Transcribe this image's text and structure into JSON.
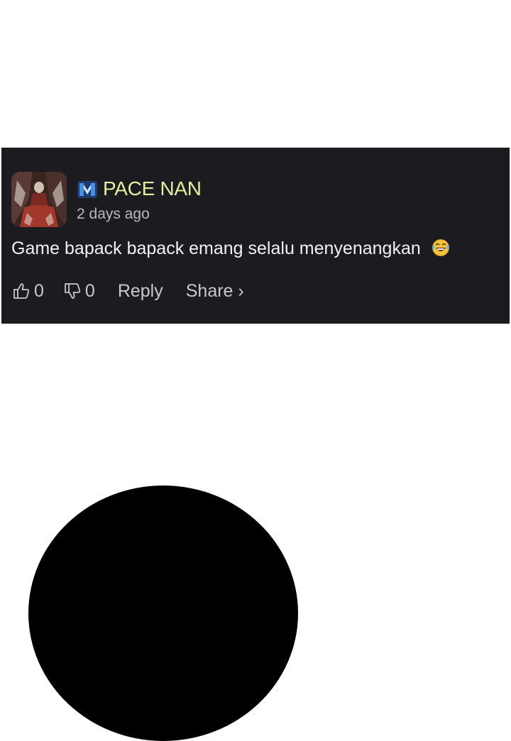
{
  "comment": {
    "username": "PACE NAN",
    "timestamp": "2 days ago",
    "text": "Game bapack bapack emang selalu menyenangkan",
    "emoji": "laughing-tears-emoji",
    "likes": "0",
    "dislikes": "0",
    "reply_label": "Reply",
    "share_label": "Share ›"
  },
  "colors": {
    "card_bg": "#1b1b20",
    "username": "#dff0a0",
    "text": "#f1f1f3",
    "muted": "#c8c9ce",
    "page_bg": "#ffffff",
    "silhouette": "#000000"
  }
}
